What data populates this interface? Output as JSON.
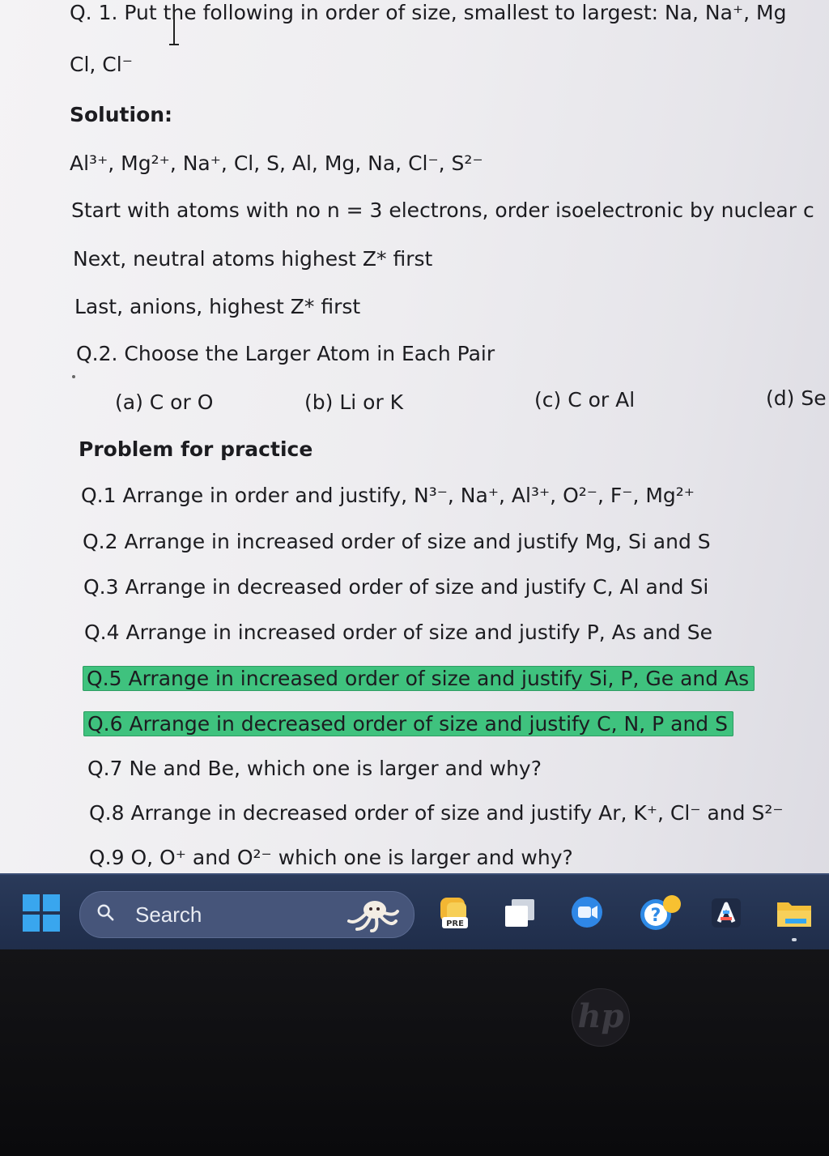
{
  "document": {
    "q1_line1": "Q. 1. Put the following in order of size, smallest to largest: Na, Na⁺, Mg",
    "q1_line2": "Cl, Cl⁻",
    "solution_heading": "Solution:",
    "solution_order": "Al³⁺, Mg²⁺, Na⁺, Cl, S, Al, Mg, Na, Cl⁻, S²⁻",
    "solution_step1": "Start with atoms with no n = 3 electrons, order isoelectronic by nuclear c",
    "solution_step2": "Next, neutral atoms highest Z* first",
    "solution_step3": "Last, anions, highest Z* first",
    "q2_heading": "Q.2. Choose the Larger Atom in Each Pair",
    "q2_options": [
      "(a) C or O",
      "(b) Li or K",
      "(c) C or Al",
      "(d) Se"
    ],
    "practice_heading": "Problem for practice",
    "practice": [
      "Q.1 Arrange in order and justify, N³⁻, Na⁺, Al³⁺, O²⁻, F⁻, Mg²⁺",
      "Q.2 Arrange in increased order of size and justify Mg, Si and S",
      "Q.3 Arrange in decreased order of size and justify C, Al and Si",
      "Q.4 Arrange in increased order of size and justify P, As and Se",
      "Q.5 Arrange in increased order of size and justify Si, P, Ge and As",
      "Q.6 Arrange in decreased order of size and justify C, N, P and S",
      "Q.7 Ne and Be, which one is larger and why?",
      "Q.8 Arrange in decreased order of size and justify Ar, K⁺, Cl⁻ and S²⁻",
      "Q.9 O, O⁺ and O²⁻ which one is larger and why?"
    ],
    "highlight_color": "#3fc27e"
  },
  "taskbar": {
    "search_label": "Search",
    "icons": [
      "windows-start-icon",
      "search-icon",
      "widgets-octopus-icon",
      "teams-pre-icon",
      "task-view-icon",
      "chat-icon",
      "help-icon",
      "app-a-icon",
      "file-explorer-icon"
    ],
    "pre_badge": "PRE"
  },
  "bezel": {
    "logo": "hp"
  }
}
